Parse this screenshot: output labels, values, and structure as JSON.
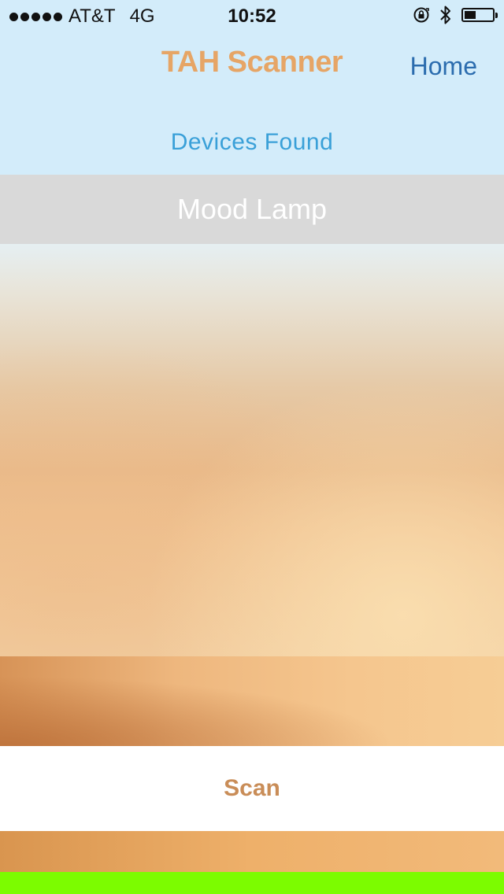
{
  "status_bar": {
    "carrier": "AT&T",
    "network": "4G",
    "time": "10:52",
    "battery_level": 0.4,
    "icons": [
      "signal-dots-icon",
      "rotation-lock-icon",
      "bluetooth-icon",
      "battery-icon"
    ]
  },
  "nav": {
    "title": "TAH Scanner",
    "home_label": "Home"
  },
  "section": {
    "title": "Devices Found"
  },
  "devices": [
    {
      "label": "Mood Lamp"
    }
  ],
  "actions": {
    "scan_label": "Scan"
  },
  "colors": {
    "header_bg": "#d3ecfa",
    "title_accent": "#e6a566",
    "home_link": "#2b6cae",
    "section_title": "#3aa0d8",
    "device_row_bg": "#d9d9d9",
    "scan_text": "#c98d58",
    "bottom_strip": "#7cfc00"
  }
}
